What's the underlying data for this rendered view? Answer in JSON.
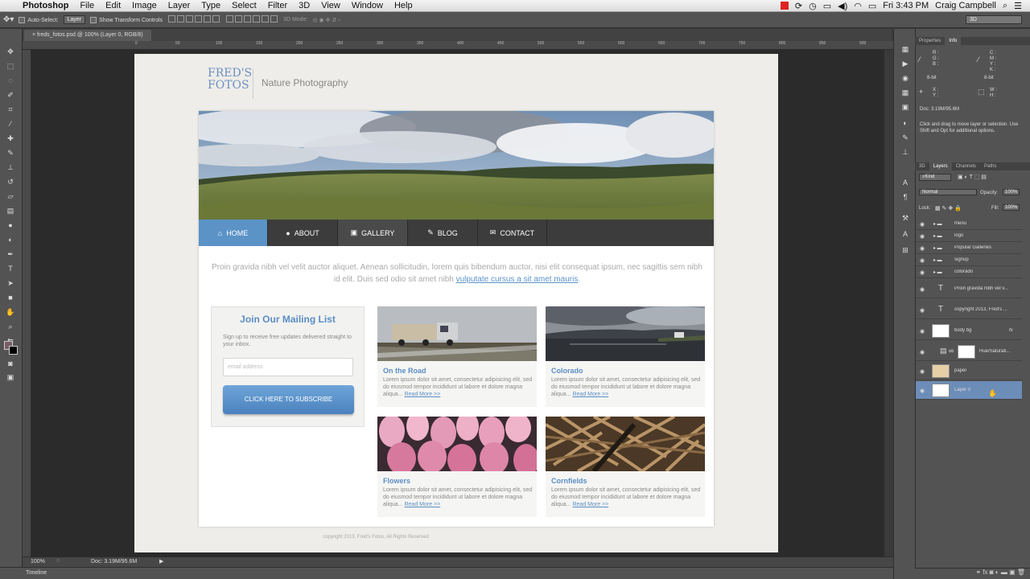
{
  "menubar": {
    "apple": "",
    "app": "Photoshop",
    "items": [
      "File",
      "Edit",
      "Image",
      "Layer",
      "Type",
      "Select",
      "Filter",
      "3D",
      "View",
      "Window",
      "Help"
    ],
    "clock": "Fri 3:43 PM",
    "user": "Craig Campbell"
  },
  "options": {
    "autoselect": "Auto-Select:",
    "target": "Layer",
    "transform": "Show Transform Controls",
    "mode3d": "3D Mode:",
    "workspace": "3D"
  },
  "document": {
    "tab": "freds_fotos.psd @ 100% (Layer 0, RGB/8)",
    "zoom": "100%",
    "doc_size": "Doc: 3.19M/95.6M",
    "ruler_ticks": [
      "0",
      "50",
      "100",
      "150",
      "200",
      "250",
      "300",
      "350",
      "400",
      "450",
      "500",
      "550",
      "600",
      "650",
      "700",
      "750",
      "800",
      "850",
      "900",
      "950",
      "1000"
    ]
  },
  "site": {
    "logo_line1": "FRED'S",
    "logo_line2": "FOTOS",
    "tagline": "Nature Photography",
    "nav": [
      {
        "label": "HOME",
        "icon": "⌂"
      },
      {
        "label": "ABOUT",
        "icon": "●"
      },
      {
        "label": "GALLERY",
        "icon": "▣"
      },
      {
        "label": "BLOG",
        "icon": "✎"
      },
      {
        "label": "CONTACT",
        "icon": "✉"
      }
    ],
    "intro": "Proin gravida nibh vel velit auctor aliquet. Aenean sollicitudin, lorem quis bibendum auctor, nisi elit consequat ipsum, nec sagittis sem nibh id elit. Duis sed odio sit amet nibh",
    "intro_link": "vulputate cursus a sit amet mauris",
    "intro_end": ".",
    "mailing": {
      "title": "Join Our Mailing List",
      "text": "Sign up to receive free updates delivered straight to your inbox.",
      "placeholder": "email address",
      "button": "CLICK HERE TO SUBSCRIBE"
    },
    "cards": [
      {
        "title": "On the Road",
        "body": "Lorem ipsum dolor sit amet, consectetur adipisicing elit, sed do eiusmod tempor incididunt ut labore et dolore magna aliqua...",
        "more": "Read More >>"
      },
      {
        "title": "Colorado",
        "body": "Lorem ipsum dolor sit amet, consectetur adipisicing elit, sed do eiusmod tempor incididunt ut labore et dolore magna aliqua...",
        "more": "Read More >>"
      },
      {
        "title": "Flowers",
        "body": "Lorem ipsum dolor sit amet, consectetur adipisicing elit, sed do eiusmod tempor incididunt ut labore et dolore magna aliqua...",
        "more": "Read More >>"
      },
      {
        "title": "Cornfields",
        "body": "Lorem ipsum dolor sit amet, consectetur adipisicing elit, sed do eiusmod tempor incididunt ut labore et dolore magna aliqua...",
        "more": "Read More >>"
      }
    ],
    "copyright": "copyright 2013, Fred's Fotos, All Rights Reserved"
  },
  "panels": {
    "top_tabs": [
      "Properties",
      "Info"
    ],
    "info_bits": [
      "8-bit",
      "8-bit"
    ],
    "info_doc": "Doc: 3.19M/95.6M",
    "hint": "Click and drag to move layer or selection. Use Shift and Opt for additional options.",
    "layer_tabs": [
      "3D",
      "Layers",
      "Channels",
      "Paths"
    ],
    "kind": "Kind",
    "blend": "Normal",
    "opacity_label": "Opacity:",
    "opacity": "100%",
    "lock_label": "Lock:",
    "fill_label": "Fill:",
    "fill": "100%",
    "layers": [
      {
        "name": "menu",
        "type": "group"
      },
      {
        "name": "logo",
        "type": "group"
      },
      {
        "name": "Popular Galleries",
        "type": "group"
      },
      {
        "name": "signup",
        "type": "group"
      },
      {
        "name": "colorado",
        "type": "group"
      },
      {
        "name": "Proin gravida nibh vel v...",
        "type": "text"
      },
      {
        "name": "copyright 2013, Fred's ...",
        "type": "text"
      },
      {
        "name": "body bg",
        "type": "pixel"
      },
      {
        "name": "Hue/Saturati...",
        "type": "adjust"
      },
      {
        "name": "paper",
        "type": "pixel"
      },
      {
        "name": "Layer 0",
        "type": "pixel"
      }
    ],
    "timeline": "Timeline"
  },
  "colors": {
    "accent": "#5b93c7",
    "nav_bg": "#3c3c3c",
    "ps_panel": "#535353",
    "selection": "#6b8db8"
  }
}
